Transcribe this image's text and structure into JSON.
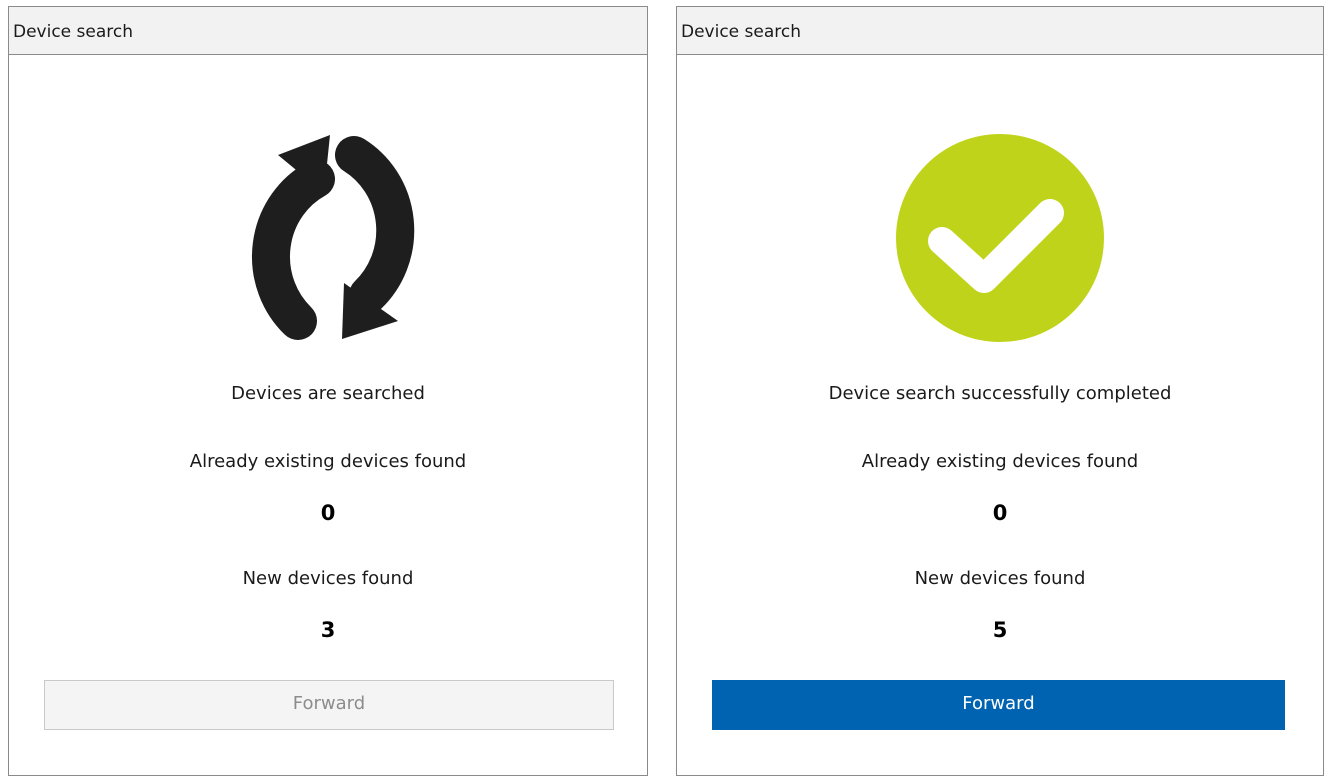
{
  "panels": [
    {
      "title": "Device search",
      "status": "Devices are searched",
      "existing_label": "Already existing devices found",
      "existing_count": "0",
      "new_label": "New devices found",
      "new_count": "3",
      "forward_label": "Forward",
      "forward_enabled": false,
      "icon": "refresh-icon",
      "icon_color": "#1e1e1e"
    },
    {
      "title": "Device search",
      "status": "Device search successfully completed",
      "existing_label": "Already existing devices found",
      "existing_count": "0",
      "new_label": "New devices found",
      "new_count": "5",
      "forward_label": "Forward",
      "forward_enabled": true,
      "icon": "success-check-icon",
      "icon_color": "#c0d31b",
      "button_color": "#0063b1"
    }
  ]
}
